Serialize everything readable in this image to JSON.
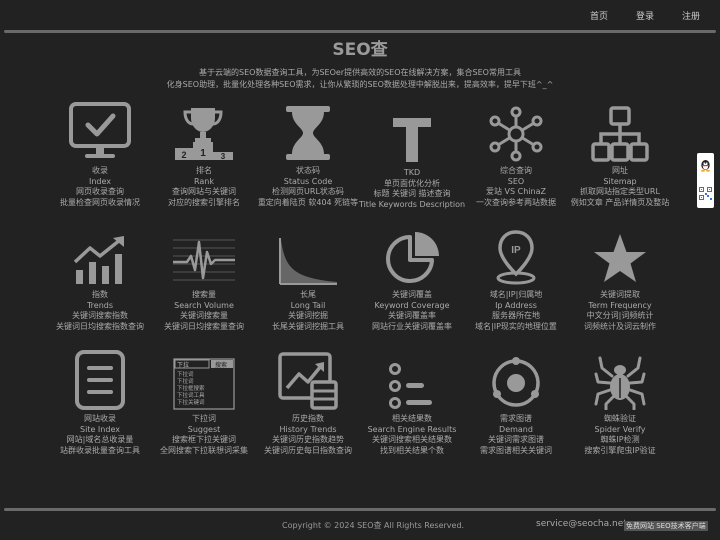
{
  "nav": {
    "home": "首页",
    "login": "登录",
    "register": "注册"
  },
  "site": {
    "title": "SEO查",
    "intro_line1": "基于云端的SEO数据查询工具，为SEOer提供高效的SEO在线解决方案，集合SEO常用工具",
    "intro_line2": "化身SEO助理，批量化处理各种SEO需求，让你从繁琐的SEO数据处理中解脱出来，提高效率，提早下班^_^"
  },
  "tools": [
    {
      "icon": "monitor-check-icon",
      "cn": "收录",
      "en": "Index",
      "d1": "网页收录查询",
      "d2": "批量检查网页收录情况"
    },
    {
      "icon": "podium-trophy-icon",
      "cn": "排名",
      "en": "Rank",
      "d1": "查询网站与关键词",
      "d2": "对应的搜索引擎排名",
      "p1": "1",
      "p2": "2",
      "p3": "3"
    },
    {
      "icon": "hourglass-icon",
      "cn": "状态码",
      "en": "Status Code",
      "d1": "检测网页URL状态码",
      "d2": "重定向着陆页 软404 死链等"
    },
    {
      "icon": "letter-t-icon",
      "cn": "TKD",
      "en": "单页面优化分析",
      "d1": "标题 关键词 描述查询",
      "d2": "Title Keywords Description"
    },
    {
      "icon": "network-hub-icon",
      "cn": "综合查询",
      "en": "SEO",
      "d1": "爱站 VS ChinaZ",
      "d2": "一次查询参考两站数据"
    },
    {
      "icon": "sitemap-icon",
      "cn": "网址",
      "en": "Sitemap",
      "d1": "抓取网站指定类型URL",
      "d2": "例如文章 产品详情页及整站"
    },
    {
      "icon": "bar-chart-up-icon",
      "cn": "指数",
      "en": "Trends",
      "d1": "关键词搜索指数",
      "d2": "关键词日均搜索指数查询"
    },
    {
      "icon": "waveform-icon",
      "cn": "搜索量",
      "en": "Search Volume",
      "d1": "关键词搜索量",
      "d2": "关键词日均搜索量查询"
    },
    {
      "icon": "long-tail-curve-icon",
      "cn": "长尾",
      "en": "Long Tail",
      "d1": "关键词挖掘",
      "d2": "长尾关键词挖掘工具"
    },
    {
      "icon": "pie-chart-icon",
      "cn": "关键词覆盖",
      "en": "Keyword Coverage",
      "d1": "关键词覆盖率",
      "d2": "网站行业关键词覆盖率"
    },
    {
      "icon": "ip-location-pin-icon",
      "cn": "域名|IP|归属地",
      "en": "Ip Address",
      "d1": "服务器所在地",
      "d2": "域名|IP现实的地理位置",
      "pin": "IP"
    },
    {
      "icon": "star-icon",
      "cn": "关键词提取",
      "en": "Term Frequency",
      "d1": "中文分词|词频统计",
      "d2": "词频统计及词云制作"
    },
    {
      "icon": "document-list-icon",
      "cn": "网站收录",
      "en": "Site Index",
      "d1": "网站|域名总收录量",
      "d2": "站群收录批量查询工具"
    },
    {
      "icon": "suggest-dropdown-icon",
      "cn": "下拉词",
      "en": "Suggest",
      "d1": "搜索框下拉关键词",
      "d2": "全网搜索下拉联想词采集",
      "box_input": "下拉",
      "box_btn": "搜索",
      "box_items": [
        "下拉词",
        "下拉词",
        "下拉框搜索",
        "下拉词工具",
        "下拉关键词"
      ]
    },
    {
      "icon": "history-chart-icon",
      "cn": "历史指数",
      "en": "History Trends",
      "d1": "关键词历史指数趋势",
      "d2": "关键词历史每日指数查询"
    },
    {
      "icon": "result-list-icon",
      "cn": "相关结果数",
      "en": "Search Engine Results",
      "d1": "关键词搜索相关结果数",
      "d2": "找到相关结果个数"
    },
    {
      "icon": "target-orbit-icon",
      "cn": "需求图谱",
      "en": "Demand",
      "d1": "关键词需求图谱",
      "d2": "需求图谱相关关键词"
    },
    {
      "icon": "spider-icon",
      "cn": "蜘蛛验证",
      "en": "Spider Verify",
      "d1": "蜘蛛IP检测",
      "d2": "搜索引擎爬虫IP验证"
    }
  ],
  "footer": {
    "copyright": "Copyright © 2024 SEO查 All Rights Reserved.",
    "email": "service@seocha.net",
    "mini": "免费网站 SEO技术客户端"
  },
  "colors": {
    "background": "#222222",
    "icon": "#999999",
    "text": "#aaaaaa",
    "rule": "#6a6a6a"
  }
}
